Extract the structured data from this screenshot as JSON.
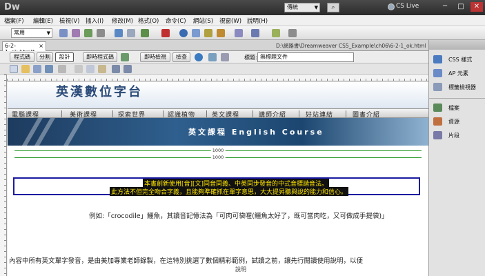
{
  "app": {
    "logo": "Dw",
    "workspace": "傳統",
    "cs_live": "CS Live",
    "window_controls": [
      "─",
      "□",
      "✕"
    ]
  },
  "menu": [
    "檔案(F)",
    "編輯(E)",
    "檢視(V)",
    "插入(I)",
    "修改(M)",
    "格式(O)",
    "命令(C)",
    "網站(S)",
    "視窗(W)",
    "說明(H)"
  ],
  "insert_bar": {
    "category": "常用"
  },
  "document": {
    "tab_label": "6-2-1_ok.html*",
    "path": "D:\\網路書\\Dreamweaver CS5_Example\\ch06\\6-2-1_ok.html"
  },
  "doc_toolbar": {
    "code": "程式碼",
    "split": "分割",
    "design": "設計",
    "live_code": "即時程式碼",
    "live_view": "即時檢視",
    "inspect": "檢查",
    "title_label": "標題:",
    "title_value": "無標題文件"
  },
  "page": {
    "banner_title": "英漢數位字台",
    "nav": [
      "電腦課程",
      "美術課程",
      "探索世界",
      "認識植物",
      "英文課程",
      "講師介紹",
      "好站連結",
      "圖書介紹"
    ],
    "course_banner": "英文課程  English Course",
    "width_indicator": "1000",
    "selected_line1": "本書創新使用[音][文]同音同義、中英同步發音的中式音標諧音法。",
    "selected_line2": "此方法不但完全吻合字義，且能夠準確抓在單字意思，大大提昇聽與說的能力和信心。",
    "example": "例如:「crocodile」鱷魚，其讀音記憶法為「可肉可袋喔(鱷魚太好了，既可當肉吃，又可做成手提袋)」",
    "paragraph": "內容中所有英文單字發音，是由美加專業老師錄製，在這特別挑選了數個精彩範例，試讀之前，讓先行閱讀使用說明，以便",
    "bottom_label": "說明"
  },
  "right_panel": {
    "group1": [
      "CSS 樣式",
      "AP 元素",
      "標籤檢視器"
    ],
    "group2": [
      "檔案",
      "資源",
      "片段"
    ]
  }
}
